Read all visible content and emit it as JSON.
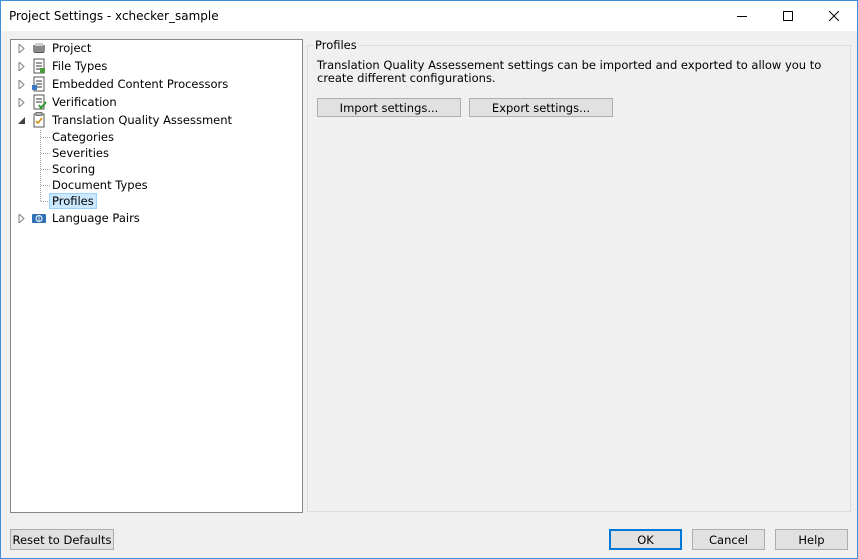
{
  "window": {
    "title": "Project Settings - xchecker_sample"
  },
  "tree": {
    "items": [
      {
        "label": "Project",
        "icon": "project-icon"
      },
      {
        "label": "File Types",
        "icon": "file-types-icon"
      },
      {
        "label": "Embedded Content Processors",
        "icon": "embedded-content-icon"
      },
      {
        "label": "Verification",
        "icon": "verification-icon"
      },
      {
        "label": "Translation Quality Assessment",
        "icon": "tqa-icon",
        "expanded": true,
        "children": [
          "Categories",
          "Severities",
          "Scoring",
          "Document Types",
          "Profiles"
        ]
      },
      {
        "label": "Language Pairs",
        "icon": "language-pairs-icon"
      }
    ],
    "selected": "Profiles"
  },
  "panel": {
    "title": "Profiles",
    "description": "Translation Quality Assessement settings can be imported and exported to allow you to create different configurations.",
    "import_label": "Import settings...",
    "export_label": "Export settings..."
  },
  "footer": {
    "reset_label": "Reset to Defaults",
    "ok_label": "OK",
    "cancel_label": "Cancel",
    "help_label": "Help"
  }
}
